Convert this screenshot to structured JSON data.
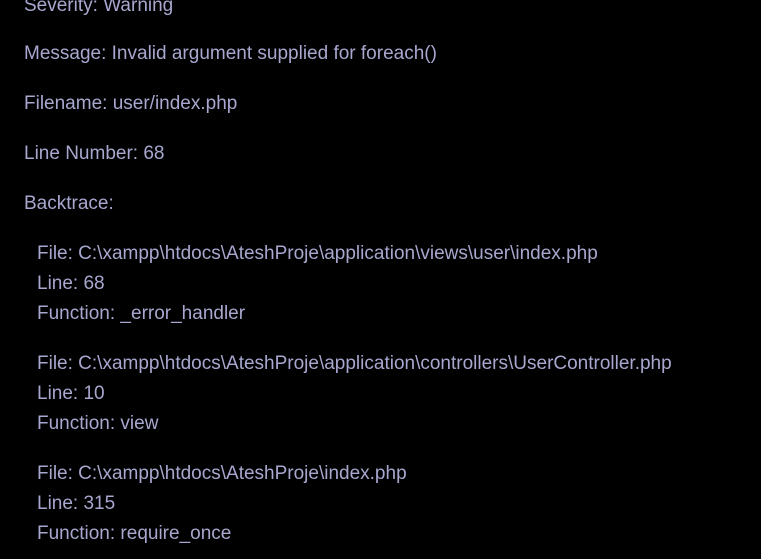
{
  "error": {
    "severity": "Severity: Warning",
    "message": "Message: Invalid argument supplied for foreach()",
    "filename": "Filename: user/index.php",
    "line_number": "Line Number: 68",
    "backtrace_label": "Backtrace:",
    "backtrace": [
      {
        "file": "File: C:\\xampp\\htdocs\\AteshProje\\application\\views\\user\\index.php",
        "line": "Line: 68",
        "function": "Function: _error_handler"
      },
      {
        "file": "File: C:\\xampp\\htdocs\\AteshProje\\application\\controllers\\UserController.php",
        "line": "Line: 10",
        "function": "Function: view"
      },
      {
        "file": "File: C:\\xampp\\htdocs\\AteshProje\\index.php",
        "line": "Line: 315",
        "function": "Function: require_once"
      }
    ]
  }
}
